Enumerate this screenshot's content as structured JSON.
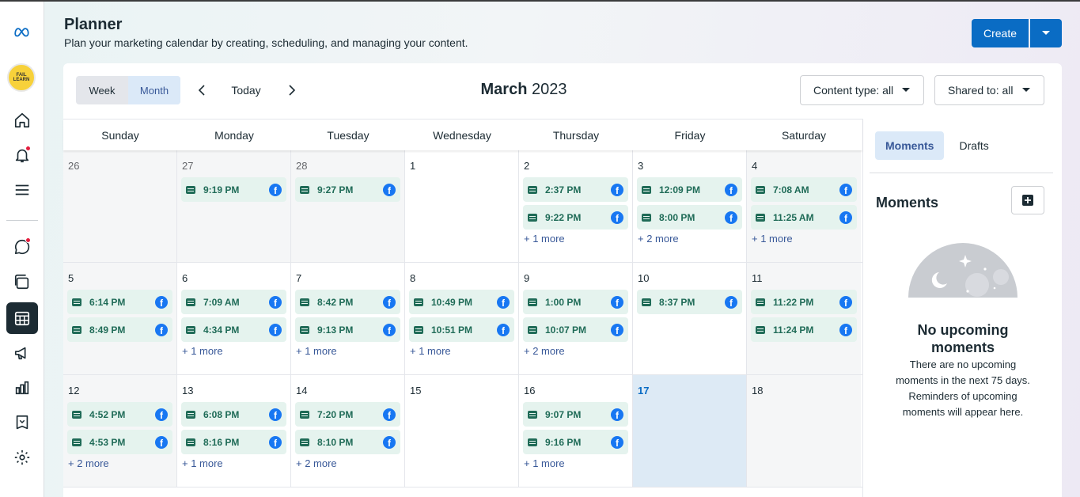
{
  "header": {
    "title": "Planner",
    "subtitle": "Plan your marketing calendar by creating, scheduling, and managing your content.",
    "create_label": "Create"
  },
  "avatar_text": "FAIL LEARN",
  "toolbar": {
    "week_label": "Week",
    "month_label": "Month",
    "today_label": "Today",
    "month_name": "March",
    "year": "2023",
    "content_type": "Content type: all",
    "shared_to": "Shared to: all"
  },
  "calendar": {
    "days_of_week": [
      "Sunday",
      "Monday",
      "Tuesday",
      "Wednesday",
      "Thursday",
      "Friday",
      "Saturday"
    ],
    "weeks": [
      [
        {
          "day": "26",
          "other": true,
          "posts": [],
          "more": ""
        },
        {
          "day": "27",
          "other": true,
          "posts": [
            "9:19 PM"
          ],
          "more": ""
        },
        {
          "day": "28",
          "other": true,
          "posts": [
            "9:27 PM"
          ],
          "more": ""
        },
        {
          "day": "1",
          "posts": [],
          "more": ""
        },
        {
          "day": "2",
          "posts": [
            "2:37 PM",
            "9:22 PM"
          ],
          "more": "+ 1 more"
        },
        {
          "day": "3",
          "posts": [
            "12:09 PM",
            "8:00 PM"
          ],
          "more": "+ 2 more"
        },
        {
          "day": "4",
          "weekend": true,
          "posts": [
            "7:08 AM",
            "11:25 AM"
          ],
          "more": "+ 1 more"
        }
      ],
      [
        {
          "day": "5",
          "weekend": true,
          "posts": [
            "6:14 PM",
            "8:49 PM"
          ],
          "more": ""
        },
        {
          "day": "6",
          "posts": [
            "7:09 AM",
            "4:34 PM"
          ],
          "more": "+ 1 more"
        },
        {
          "day": "7",
          "posts": [
            "8:42 PM",
            "9:13 PM"
          ],
          "more": "+ 1 more"
        },
        {
          "day": "8",
          "posts": [
            "10:49 PM",
            "10:51 PM"
          ],
          "more": "+ 1 more"
        },
        {
          "day": "9",
          "posts": [
            "1:00 PM",
            "10:07 PM"
          ],
          "more": "+ 2 more"
        },
        {
          "day": "10",
          "posts": [
            "8:37 PM"
          ],
          "more": ""
        },
        {
          "day": "11",
          "weekend": true,
          "posts": [
            "11:22 PM",
            "11:24 PM"
          ],
          "more": ""
        }
      ],
      [
        {
          "day": "12",
          "weekend": true,
          "posts": [
            "4:52 PM",
            "4:53 PM"
          ],
          "more": "+ 2 more"
        },
        {
          "day": "13",
          "posts": [
            "6:08 PM",
            "8:16 PM"
          ],
          "more": "+ 1 more"
        },
        {
          "day": "14",
          "posts": [
            "7:20 PM",
            "8:10 PM"
          ],
          "more": "+ 2 more"
        },
        {
          "day": "15",
          "posts": [],
          "more": ""
        },
        {
          "day": "16",
          "posts": [
            "9:07 PM",
            "9:16 PM"
          ],
          "more": "+ 1 more"
        },
        {
          "day": "17",
          "today": true,
          "posts": [],
          "more": ""
        },
        {
          "day": "18",
          "weekend": true,
          "posts": [],
          "more": ""
        }
      ]
    ]
  },
  "right_panel": {
    "tabs": [
      "Moments",
      "Drafts"
    ],
    "heading": "Moments",
    "empty_title": "No upcoming moments",
    "empty_text": "There are no upcoming moments in the next 75 days. Reminders of upcoming moments will appear here."
  },
  "colors": {
    "accent": "#0a6cc4",
    "post_bg": "#e5f3ee",
    "post_text": "#1f6b57",
    "facebook": "#1877f2",
    "today_bg": "#ddeaf5"
  },
  "icons": {
    "nav": [
      "meta-logo-icon",
      "home-icon",
      "notifications-icon",
      "menu-icon",
      "chat-icon",
      "content-icon",
      "planner-icon",
      "ads-icon",
      "insights-icon",
      "inbox-icon",
      "settings-icon"
    ]
  }
}
